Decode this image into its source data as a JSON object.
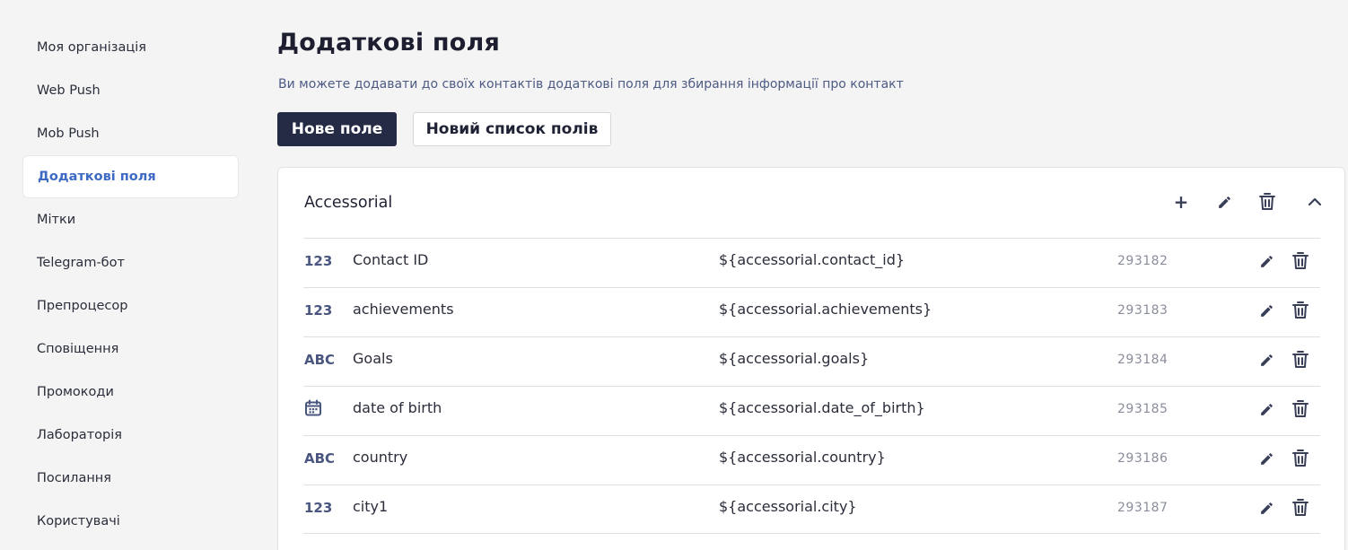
{
  "sidebar": {
    "items": [
      {
        "label": "Моя організація"
      },
      {
        "label": "Web Push"
      },
      {
        "label": "Mob Push"
      },
      {
        "label": "Додаткові поля"
      },
      {
        "label": "Мітки"
      },
      {
        "label": "Telegram-бот"
      },
      {
        "label": "Препроцесор"
      },
      {
        "label": "Сповіщення"
      },
      {
        "label": "Промокоди"
      },
      {
        "label": "Лабораторія"
      },
      {
        "label": "Посилання"
      },
      {
        "label": "Користувачі"
      }
    ],
    "active_index": 3
  },
  "page": {
    "title": "Додаткові поля",
    "subtitle": "Ви можете додавати до своїх контактів додаткові поля для збирання інформації про контакт"
  },
  "actions": {
    "new_field": "Нове поле",
    "new_field_list": "Новий список полів"
  },
  "group": {
    "title": "Accessorial",
    "icons": [
      "plus-icon",
      "pencil-icon",
      "trash-icon",
      "chevron-up-icon"
    ],
    "fields": [
      {
        "type": "number",
        "type_label": "123",
        "name": "Contact ID",
        "variable": "${accessorial.contact_id}",
        "id": "293182"
      },
      {
        "type": "number",
        "type_label": "123",
        "name": "achievements",
        "variable": "${accessorial.achievements}",
        "id": "293183"
      },
      {
        "type": "string",
        "type_label": "ABC",
        "name": "Goals",
        "variable": "${accessorial.goals}",
        "id": "293184"
      },
      {
        "type": "date",
        "type_label": "",
        "name": "date of birth",
        "variable": "${accessorial.date_of_birth}",
        "id": "293185"
      },
      {
        "type": "string",
        "type_label": "ABC",
        "name": "country",
        "variable": "${accessorial.country}",
        "id": "293186"
      },
      {
        "type": "number",
        "type_label": "123",
        "name": "city1",
        "variable": "${accessorial.city}",
        "id": "293187"
      }
    ]
  },
  "colors": {
    "primary_button": "#252a45",
    "active_link": "#3d6ac4",
    "type_icon": "#4a5680",
    "background": "#f4f4f5"
  }
}
